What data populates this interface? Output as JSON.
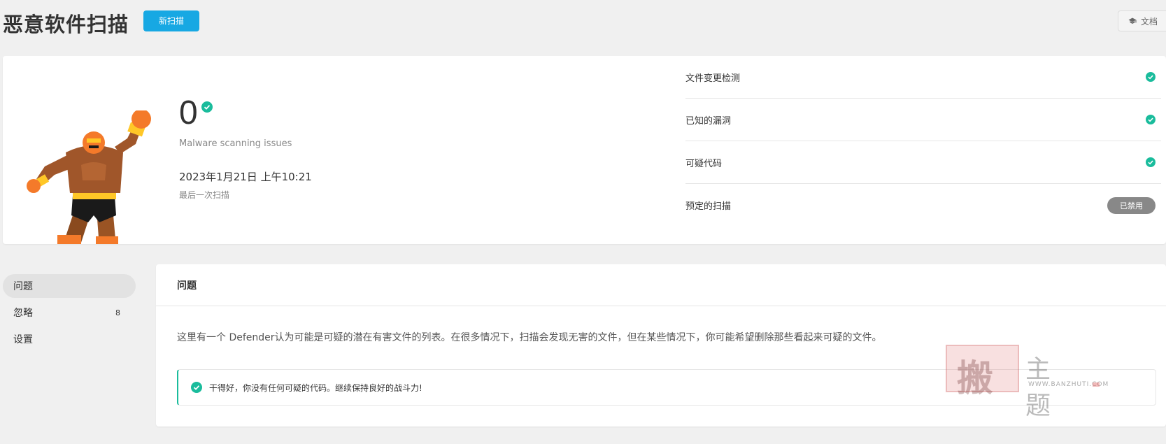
{
  "header": {
    "title": "恶意软件扫描",
    "new_scan_label": "新扫描",
    "docs_label": "文档"
  },
  "summary": {
    "issues_count": "0",
    "issues_label": "Malware scanning issues",
    "last_scan_date": "2023年1月21日 上午10:21",
    "last_scan_label": "最后一次扫描",
    "status_items": [
      {
        "label": "文件变更检测",
        "status": "ok"
      },
      {
        "label": "已知的漏洞",
        "status": "ok"
      },
      {
        "label": "可疑代码",
        "status": "ok"
      },
      {
        "label": "预定的扫描",
        "status": "disabled",
        "badge": "已禁用"
      }
    ]
  },
  "sidebar": {
    "items": [
      {
        "label": "问题",
        "active": true
      },
      {
        "label": "忽略",
        "count": "8"
      },
      {
        "label": "设置"
      }
    ]
  },
  "issues_panel": {
    "title": "问题",
    "description": "这里有一个 Defender认为可能是可疑的潜在有害文件的列表。在很多情况下，扫描会发现无害的文件，但在某些情况下，你可能希望删除那些看起来可疑的文件。",
    "notice": "干得好，你没有任何可疑的代码。继续保持良好的战斗力!"
  },
  "watermark": {
    "seal_char": "搬",
    "text": "主题",
    "url": "WWW.BANZHUTI.COM"
  },
  "colors": {
    "accent": "#17a8e3",
    "success": "#1abc9c",
    "badge_gray": "#888888"
  }
}
